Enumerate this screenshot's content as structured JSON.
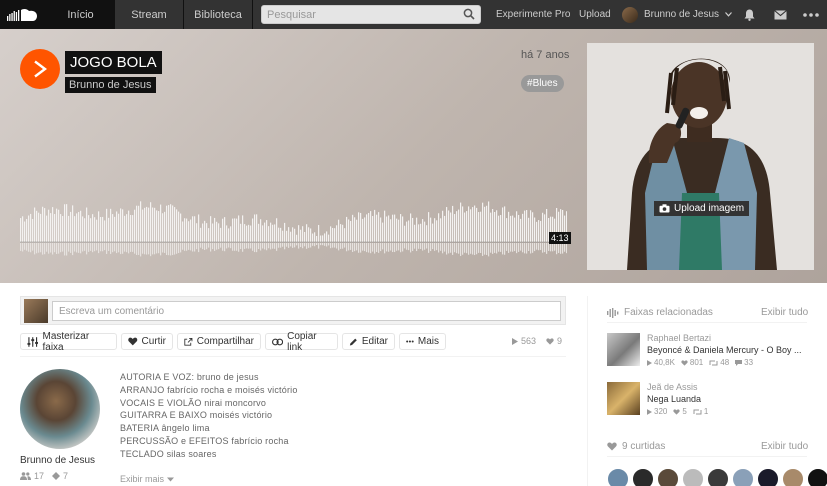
{
  "nav": {
    "home": "Início",
    "stream": "Stream",
    "library": "Biblioteca",
    "search_placeholder": "Pesquisar",
    "pro": "Experimente Pro",
    "upload": "Upload",
    "user": "Brunno de Jesus"
  },
  "track": {
    "title": "JOGO BOLA",
    "artist": "Brunno de Jesus",
    "posted": "há 7 anos",
    "tag": "Blues",
    "duration": "4:13",
    "upload_image": "Upload imagem",
    "comment_placeholder": "Escreva um comentário",
    "actions": {
      "master": "Masterizar faixa",
      "like": "Curtir",
      "share": "Compartilhar",
      "copy": "Copiar link",
      "edit": "Editar",
      "more": "Mais"
    },
    "plays": "563",
    "likes": "9",
    "followers": "17",
    "tracks": "7",
    "description": [
      "AUTORIA E VOZ: bruno de jesus",
      "ARRANJO fabrício rocha e moisés victório",
      "VOCAIS E VIOLÃO nirai moncorvo",
      "GUITARRA E BAIXO moisés victório",
      "BATERIA ângelo lima",
      "PERCUSSÃO e EFEITOS fabrício rocha",
      "TECLADO silas soares"
    ],
    "show_more": "Exibir mais"
  },
  "sidebar": {
    "related_title": "Faixas relacionadas",
    "show_all": "Exibir tudo",
    "related": [
      {
        "user": "Raphael Bertazi",
        "title": "Beyoncé & Daniela Mercury - O Boy ...",
        "plays": "40,8K",
        "likes": "801",
        "reposts": "48",
        "comments": "33"
      },
      {
        "user": "Jeã de Assis",
        "title": "Nega Luanda",
        "plays": "320",
        "likes": "5",
        "reposts": "1"
      }
    ],
    "likes_title": "9 curtidas",
    "likes_show_all": "Exibir tudo"
  },
  "colors": {
    "accent": "#ff5500",
    "nav": "#333333"
  }
}
